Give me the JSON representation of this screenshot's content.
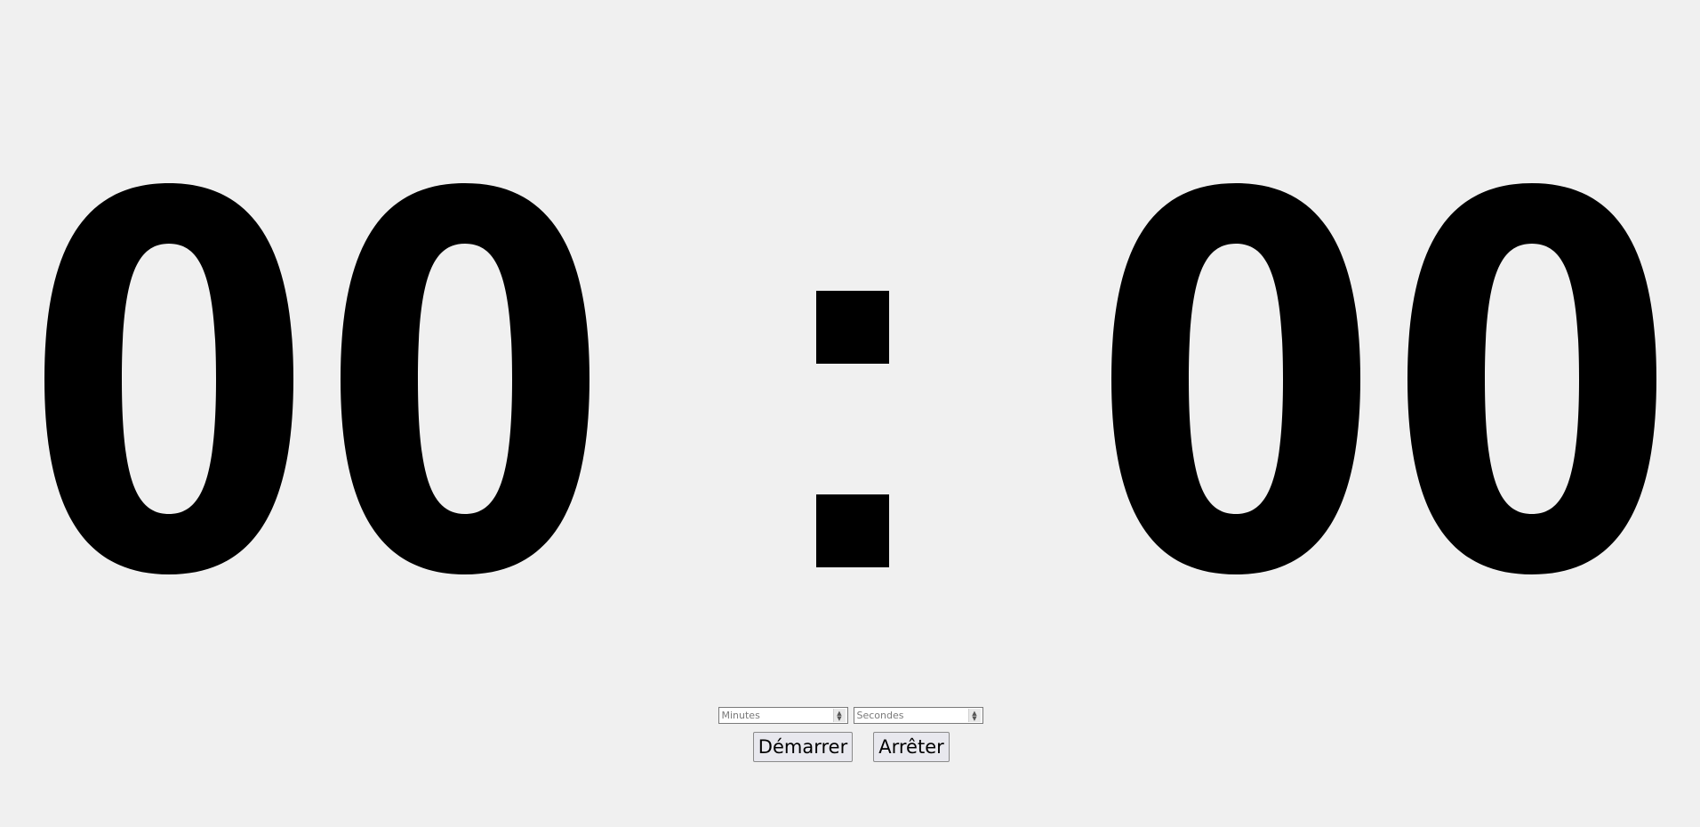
{
  "clock": {
    "minutes_tens": "0",
    "minutes_ones": "0",
    "separator": ":",
    "seconds_tens": "0",
    "seconds_ones": "0"
  },
  "inputs": {
    "minutes_placeholder": "Minutes",
    "seconds_placeholder": "Secondes",
    "minutes_value": "",
    "seconds_value": ""
  },
  "buttons": {
    "start_label": "Démarrer",
    "stop_label": "Arrêter"
  },
  "icons": {
    "spinner_up": "▲",
    "spinner_down": "▼"
  }
}
